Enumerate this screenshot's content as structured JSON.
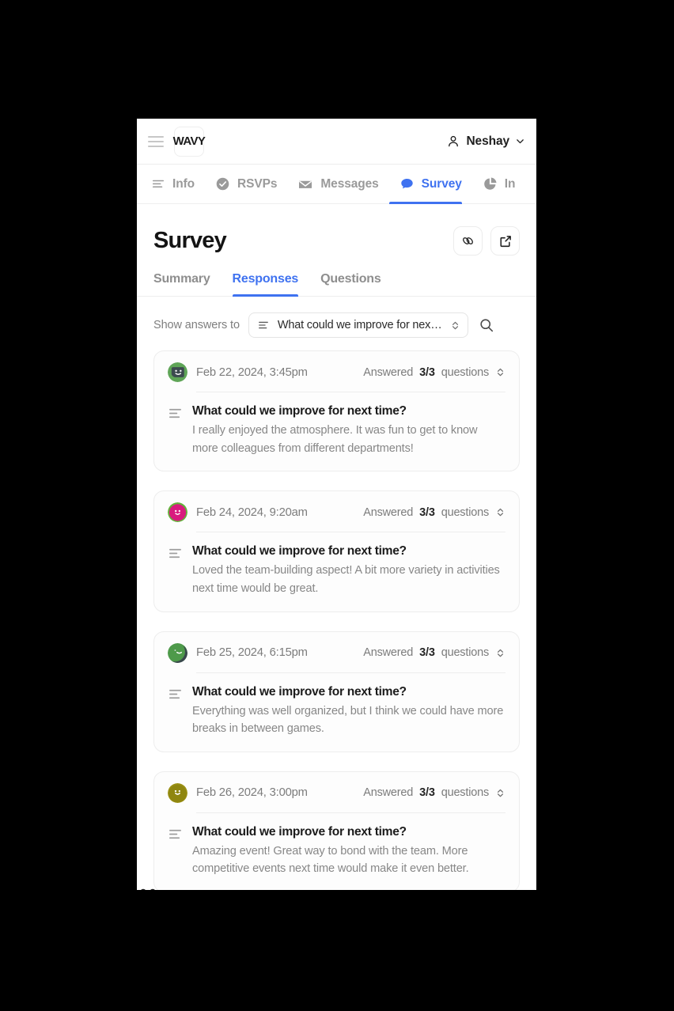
{
  "colors": {
    "accent": "#3f72f0",
    "text_primary": "#1c1c1c",
    "text_muted": "#7c7c7c",
    "border": "#ededed",
    "page_background": "#000000",
    "viewport_background": "#ffffff"
  },
  "topbar": {
    "menu_icon": "hamburger-icon",
    "logo_text": "WAVY",
    "user_icon": "person-icon",
    "user_name": "Neshay",
    "user_chevron_icon": "chevron-down-icon"
  },
  "main_tabs": [
    {
      "label": "Info",
      "icon": "text-lines-icon",
      "active": false
    },
    {
      "label": "RSVPs",
      "icon": "check-circle-icon",
      "active": false
    },
    {
      "label": "Messages",
      "icon": "envelope-icon",
      "active": false
    },
    {
      "label": "Survey",
      "icon": "chat-bubble-icon",
      "active": true
    },
    {
      "label": "In",
      "icon": "pie-chart-icon",
      "active": false
    }
  ],
  "page": {
    "title": "Survey",
    "actions": [
      {
        "name": "copy-link-button",
        "icon": "link-icon"
      },
      {
        "name": "open-external-button",
        "icon": "external-link-icon"
      }
    ]
  },
  "sub_tabs": [
    {
      "label": "Summary",
      "active": false
    },
    {
      "label": "Responses",
      "active": true
    },
    {
      "label": "Questions",
      "active": false
    }
  ],
  "filter": {
    "label": "Show answers to",
    "select_icon": "text-lines-icon",
    "select_value": "What could we improve for next…",
    "select_chevron_icon": "chevron-updown-icon",
    "search_icon": "search-icon"
  },
  "responses": [
    {
      "avatar": {
        "ring": "#5fa557",
        "face": "#3c4a4f",
        "style": "mask-face"
      },
      "date": "Feb 22, 2024, 3:45pm",
      "answered_prefix": "Answered",
      "answered_count": "3/3",
      "answered_suffix": "questions",
      "expand_icon": "chevron-updown-icon",
      "question_icon": "text-lines-icon",
      "question": "What could we improve for next time?",
      "answer": "I really enjoyed the atmosphere. It was fun to get to know more colleagues from different departments!"
    },
    {
      "avatar": {
        "ring": "#63b33b",
        "face": "#d81b7e",
        "style": "round-face"
      },
      "date": "Feb 24, 2024, 9:20am",
      "answered_prefix": "Answered",
      "answered_count": "3/3",
      "answered_suffix": "questions",
      "expand_icon": "chevron-updown-icon",
      "question_icon": "text-lines-icon",
      "question": "What could we improve for next time?",
      "answer": "Loved the team-building aspect! A bit more variety in activities next time would be great."
    },
    {
      "avatar": {
        "ring": "#4e9a4a",
        "face": "#3a474d",
        "style": "crescent-face"
      },
      "date": "Feb 25, 2024, 6:15pm",
      "answered_prefix": "Answered",
      "answered_count": "3/3",
      "answered_suffix": "questions",
      "expand_icon": "chevron-updown-icon",
      "question_icon": "text-lines-icon",
      "question": "What could we improve for next time?",
      "answer": "Everything was well organized, but I think we could have more breaks in between games."
    },
    {
      "avatar": {
        "ring": "#9b9114",
        "face": "#8f8610",
        "style": "solid-face"
      },
      "date": "Feb 26, 2024, 3:00pm",
      "answered_prefix": "Answered",
      "answered_count": "3/3",
      "answered_suffix": "questions",
      "expand_icon": "chevron-updown-icon",
      "question_icon": "text-lines-icon",
      "question": "What could we improve for next time?",
      "answer": "Amazing event! Great way to bond with the team. More competitive events next time would make it even better."
    }
  ]
}
